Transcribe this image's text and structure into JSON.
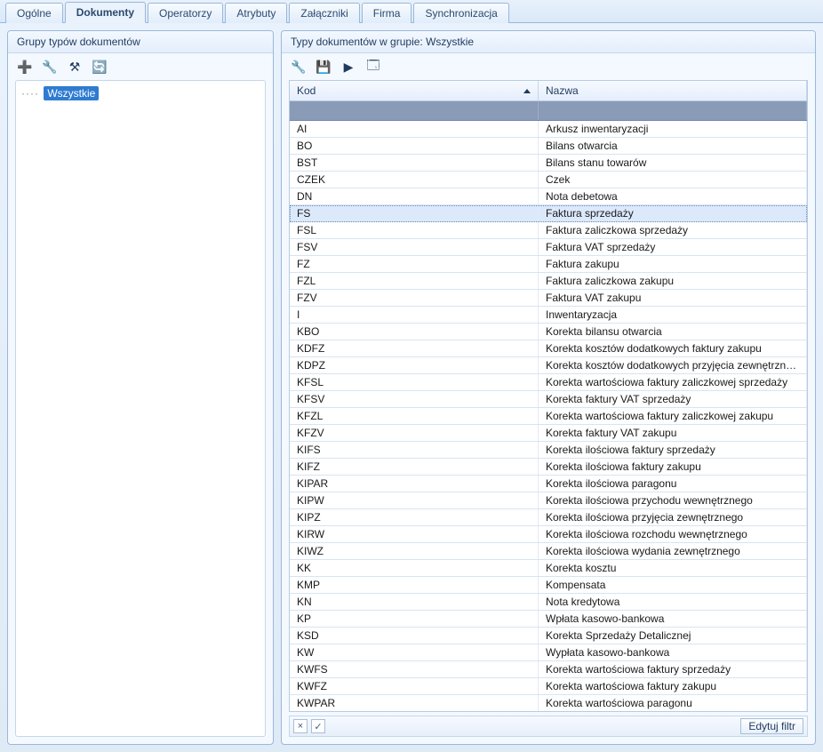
{
  "tabs": [
    {
      "label": "Ogólne"
    },
    {
      "label": "Dokumenty"
    },
    {
      "label": "Operatorzy"
    },
    {
      "label": "Atrybuty"
    },
    {
      "label": "Załączniki"
    },
    {
      "label": "Firma"
    },
    {
      "label": "Synchronizacja"
    }
  ],
  "active_tab": 1,
  "left_panel": {
    "title": "Grupy typów dokumentów",
    "toolbar_icons": [
      "add-icon",
      "wrench-icon",
      "tools-icon",
      "refresh-icon"
    ],
    "tree_root": "Wszystkie"
  },
  "right_panel": {
    "title": "Typy dokumentów w grupie: Wszystkie",
    "toolbar_icons": [
      "wrench-icon",
      "save-icon",
      "play-icon",
      "window-icon"
    ],
    "columns": {
      "kod": "Kod",
      "nazwa": "Nazwa"
    },
    "selected_index": 5,
    "rows": [
      {
        "kod": "AI",
        "nazwa": "Arkusz inwentaryzacji"
      },
      {
        "kod": "BO",
        "nazwa": "Bilans otwarcia"
      },
      {
        "kod": "BST",
        "nazwa": "Bilans stanu towarów"
      },
      {
        "kod": "CZEK",
        "nazwa": "Czek"
      },
      {
        "kod": "DN",
        "nazwa": "Nota debetowa"
      },
      {
        "kod": "FS",
        "nazwa": "Faktura sprzedaży"
      },
      {
        "kod": "FSL",
        "nazwa": "Faktura zaliczkowa sprzedaży"
      },
      {
        "kod": "FSV",
        "nazwa": "Faktura VAT sprzedaży"
      },
      {
        "kod": "FZ",
        "nazwa": "Faktura zakupu"
      },
      {
        "kod": "FZL",
        "nazwa": "Faktura zaliczkowa zakupu"
      },
      {
        "kod": "FZV",
        "nazwa": "Faktura VAT zakupu"
      },
      {
        "kod": "I",
        "nazwa": "Inwentaryzacja"
      },
      {
        "kod": "KBO",
        "nazwa": "Korekta bilansu otwarcia"
      },
      {
        "kod": "KDFZ",
        "nazwa": "Korekta kosztów dodatkowych faktury zakupu"
      },
      {
        "kod": "KDPZ",
        "nazwa": "Korekta kosztów dodatkowych przyjęcia zewnętrznego"
      },
      {
        "kod": "KFSL",
        "nazwa": "Korekta wartościowa faktury zaliczkowej sprzedaży"
      },
      {
        "kod": "KFSV",
        "nazwa": "Korekta faktury VAT sprzedaży"
      },
      {
        "kod": "KFZL",
        "nazwa": "Korekta wartościowa faktury zaliczkowej zakupu"
      },
      {
        "kod": "KFZV",
        "nazwa": "Korekta faktury VAT zakupu"
      },
      {
        "kod": "KIFS",
        "nazwa": "Korekta ilościowa faktury sprzedaży"
      },
      {
        "kod": "KIFZ",
        "nazwa": "Korekta ilościowa faktury zakupu"
      },
      {
        "kod": "KIPAR",
        "nazwa": "Korekta ilościowa paragonu"
      },
      {
        "kod": "KIPW",
        "nazwa": "Korekta ilościowa przychodu wewnętrznego"
      },
      {
        "kod": "KIPZ",
        "nazwa": "Korekta ilościowa przyjęcia zewnętrznego"
      },
      {
        "kod": "KIRW",
        "nazwa": "Korekta ilościowa rozchodu wewnętrznego"
      },
      {
        "kod": "KIWZ",
        "nazwa": "Korekta ilościowa wydania zewnętrznego"
      },
      {
        "kod": "KK",
        "nazwa": "Korekta kosztu"
      },
      {
        "kod": "KMP",
        "nazwa": "Kompensata"
      },
      {
        "kod": "KN",
        "nazwa": "Nota kredytowa"
      },
      {
        "kod": "KP",
        "nazwa": "Wpłata kasowo-bankowa"
      },
      {
        "kod": "KSD",
        "nazwa": "Korekta Sprzedaży Detalicznej"
      },
      {
        "kod": "KW",
        "nazwa": "Wypłata kasowo-bankowa"
      },
      {
        "kod": "KWFS",
        "nazwa": "Korekta wartościowa faktury sprzedaży"
      },
      {
        "kod": "KWFZ",
        "nazwa": "Korekta wartościowa faktury zakupu"
      },
      {
        "kod": "KWPAR",
        "nazwa": "Korekta wartościowa paragonu"
      }
    ]
  },
  "filter_bar": {
    "close_glyph": "×",
    "check_glyph": "✓",
    "edit_label": "Edytuj filtr"
  }
}
